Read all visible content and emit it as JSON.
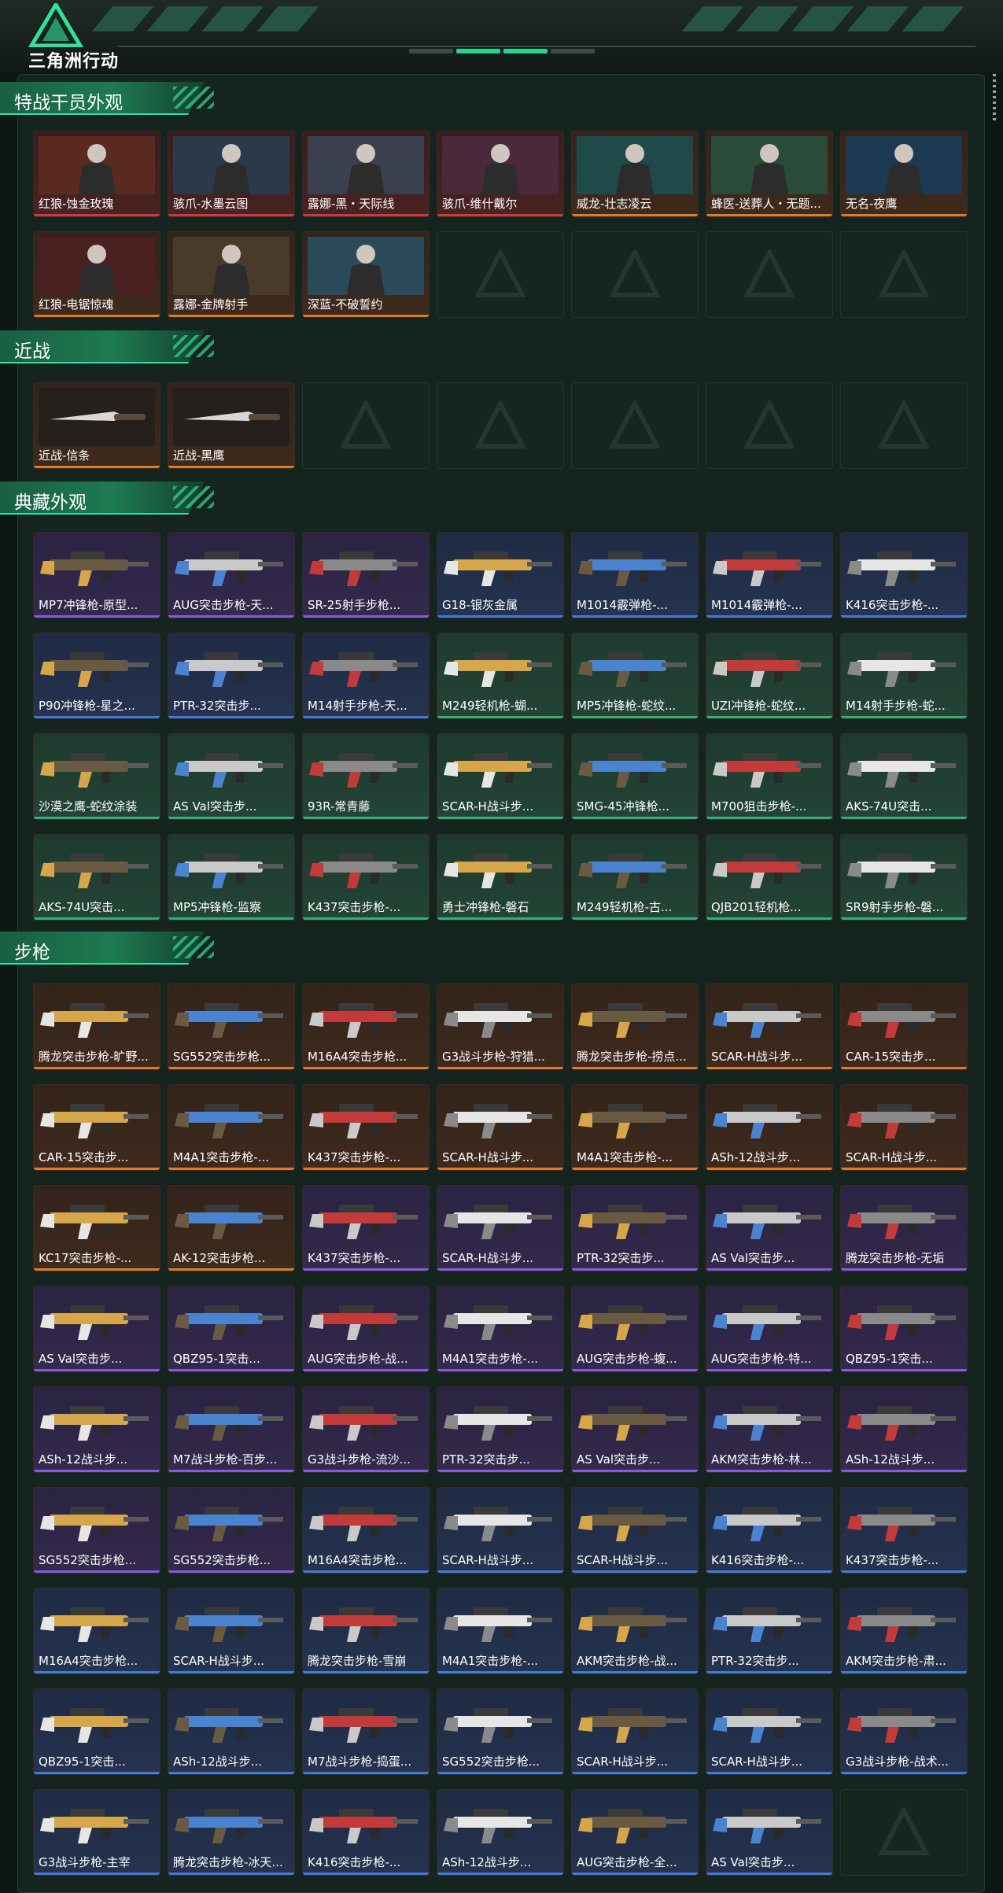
{
  "header": {
    "logo_text": "三角洲行动"
  },
  "sections": [
    {
      "title": "特战干员外观",
      "items": [
        {
          "label": "红狼-蚀金玫瑰",
          "rarity": "red"
        },
        {
          "label": "骇爪-水墨云图",
          "rarity": "red"
        },
        {
          "label": "露娜-黑・天际线",
          "rarity": "red"
        },
        {
          "label": "骇爪-维什戴尔",
          "rarity": "red"
        },
        {
          "label": "威龙-壮志凌云",
          "rarity": "orange"
        },
        {
          "label": "蜂医-送葬人・无题...",
          "rarity": "orange"
        },
        {
          "label": "无名-夜鹰",
          "rarity": "orange"
        },
        {
          "label": "红狼-电锯惊魂",
          "rarity": "orange"
        },
        {
          "label": "露娜-金牌射手",
          "rarity": "orange"
        },
        {
          "label": "深蓝-不破誓约",
          "rarity": "orange"
        }
      ]
    },
    {
      "title": "近战",
      "items": [
        {
          "label": "近战-信条",
          "rarity": "orange"
        },
        {
          "label": "近战-黑鹰",
          "rarity": "orange"
        }
      ]
    },
    {
      "title": "典藏外观",
      "items": [
        {
          "label": "MP7冲锋枪-原型...",
          "rarity": "purple"
        },
        {
          "label": "AUG突击步枪-天...",
          "rarity": "purple"
        },
        {
          "label": "SR-25射手步枪...",
          "rarity": "purple"
        },
        {
          "label": "G18-银灰金属",
          "rarity": "blue"
        },
        {
          "label": "M1014霰弹枪-...",
          "rarity": "blue"
        },
        {
          "label": "M1014霰弹枪-...",
          "rarity": "blue"
        },
        {
          "label": "K416突击步枪-...",
          "rarity": "blue"
        },
        {
          "label": "P90冲锋枪-星之...",
          "rarity": "blue"
        },
        {
          "label": "PTR-32突击步...",
          "rarity": "blue"
        },
        {
          "label": "M14射手步枪-天...",
          "rarity": "blue"
        },
        {
          "label": "M249轻机枪-蝴...",
          "rarity": "green"
        },
        {
          "label": "MP5冲锋枪-蛇纹...",
          "rarity": "green"
        },
        {
          "label": "UZI冲锋枪-蛇纹...",
          "rarity": "green"
        },
        {
          "label": "M14射手步枪-蛇...",
          "rarity": "green"
        },
        {
          "label": "沙漠之鹰-蛇纹涂装",
          "rarity": "green"
        },
        {
          "label": "AS Val突击步...",
          "rarity": "green"
        },
        {
          "label": "93R-常青藤",
          "rarity": "green"
        },
        {
          "label": "SCAR-H战斗步...",
          "rarity": "green"
        },
        {
          "label": "SMG-45冲锋枪...",
          "rarity": "green"
        },
        {
          "label": "M700狙击步枪-...",
          "rarity": "green"
        },
        {
          "label": "AKS-74U突击...",
          "rarity": "green"
        },
        {
          "label": "AKS-74U突击...",
          "rarity": "green"
        },
        {
          "label": "MP5冲锋枪-监察",
          "rarity": "green"
        },
        {
          "label": "K437突击步枪-...",
          "rarity": "green"
        },
        {
          "label": "勇士冲锋枪-磐石",
          "rarity": "green"
        },
        {
          "label": "M249轻机枪-古...",
          "rarity": "green"
        },
        {
          "label": "QJB201轻机枪...",
          "rarity": "green"
        },
        {
          "label": "SR9射手步枪-磐...",
          "rarity": "green"
        }
      ]
    },
    {
      "title": "步枪",
      "items": [
        {
          "label": "腾龙突击步枪-旷野...",
          "rarity": "orange"
        },
        {
          "label": "SG552突击步枪...",
          "rarity": "orange"
        },
        {
          "label": "M16A4突击步枪...",
          "rarity": "orange"
        },
        {
          "label": "G3战斗步枪-狩猎...",
          "rarity": "orange"
        },
        {
          "label": "腾龙突击步枪-捞点...",
          "rarity": "orange"
        },
        {
          "label": "SCAR-H战斗步...",
          "rarity": "orange"
        },
        {
          "label": "CAR-15突击步...",
          "rarity": "orange"
        },
        {
          "label": "CAR-15突击步...",
          "rarity": "orange"
        },
        {
          "label": "M4A1突击步枪-...",
          "rarity": "orange"
        },
        {
          "label": "K437突击步枪-...",
          "rarity": "orange"
        },
        {
          "label": "SCAR-H战斗步...",
          "rarity": "orange"
        },
        {
          "label": "M4A1突击步枪-...",
          "rarity": "orange"
        },
        {
          "label": "ASh-12战斗步...",
          "rarity": "orange"
        },
        {
          "label": "SCAR-H战斗步...",
          "rarity": "orange"
        },
        {
          "label": "KC17突击步枪-...",
          "rarity": "orange"
        },
        {
          "label": "AK-12突击步枪...",
          "rarity": "orange"
        },
        {
          "label": "K437突击步枪-...",
          "rarity": "purple"
        },
        {
          "label": "SCAR-H战斗步...",
          "rarity": "purple"
        },
        {
          "label": "PTR-32突击步...",
          "rarity": "purple"
        },
        {
          "label": "AS Val突击步...",
          "rarity": "purple"
        },
        {
          "label": "腾龙突击步枪-无垢",
          "rarity": "purple"
        },
        {
          "label": "AS Val突击步...",
          "rarity": "purple"
        },
        {
          "label": "QBZ95-1突击...",
          "rarity": "purple"
        },
        {
          "label": "AUG突击步枪-战...",
          "rarity": "purple"
        },
        {
          "label": "M4A1突击步枪-...",
          "rarity": "purple"
        },
        {
          "label": "AUG突击步枪-蝮...",
          "rarity": "purple"
        },
        {
          "label": "AUG突击步枪-特...",
          "rarity": "purple"
        },
        {
          "label": "QBZ95-1突击...",
          "rarity": "purple"
        },
        {
          "label": "ASh-12战斗步...",
          "rarity": "purple"
        },
        {
          "label": "M7战斗步枪-百步...",
          "rarity": "purple"
        },
        {
          "label": "G3战斗步枪-流沙...",
          "rarity": "purple"
        },
        {
          "label": "PTR-32突击步...",
          "rarity": "purple"
        },
        {
          "label": "AS Val突击步...",
          "rarity": "purple"
        },
        {
          "label": "AKM突击步枪-林...",
          "rarity": "purple"
        },
        {
          "label": "ASh-12战斗步...",
          "rarity": "purple"
        },
        {
          "label": "SG552突击步枪...",
          "rarity": "purple"
        },
        {
          "label": "SG552突击步枪...",
          "rarity": "purple"
        },
        {
          "label": "M16A4突击步枪...",
          "rarity": "blue"
        },
        {
          "label": "SCAR-H战斗步...",
          "rarity": "blue"
        },
        {
          "label": "SCAR-H战斗步...",
          "rarity": "blue"
        },
        {
          "label": "K416突击步枪-...",
          "rarity": "blue"
        },
        {
          "label": "K437突击步枪-...",
          "rarity": "blue"
        },
        {
          "label": "M16A4突击步枪...",
          "rarity": "blue"
        },
        {
          "label": "SCAR-H战斗步...",
          "rarity": "blue"
        },
        {
          "label": "腾龙突击步枪-雪崩",
          "rarity": "blue"
        },
        {
          "label": "M4A1突击步枪-...",
          "rarity": "blue"
        },
        {
          "label": "AKM突击步枪-战...",
          "rarity": "blue"
        },
        {
          "label": "PTR-32突击步...",
          "rarity": "blue"
        },
        {
          "label": "AKM突击步枪-肃...",
          "rarity": "blue"
        },
        {
          "label": "QBZ95-1突击...",
          "rarity": "blue"
        },
        {
          "label": "ASh-12战斗步...",
          "rarity": "blue"
        },
        {
          "label": "M7战斗步枪-捣蛋...",
          "rarity": "blue"
        },
        {
          "label": "SG552突击步枪...",
          "rarity": "blue"
        },
        {
          "label": "SCAR-H战斗步...",
          "rarity": "blue"
        },
        {
          "label": "SCAR-H战斗步...",
          "rarity": "blue"
        },
        {
          "label": "G3战斗步枪-战术...",
          "rarity": "blue"
        },
        {
          "label": "G3战斗步枪-主宰",
          "rarity": "blue"
        },
        {
          "label": "腾龙突击步枪-冰天...",
          "rarity": "blue"
        },
        {
          "label": "K416突击步枪-...",
          "rarity": "blue"
        },
        {
          "label": "ASh-12战斗步...",
          "rarity": "blue"
        },
        {
          "label": "AUG突击步枪-全...",
          "rarity": "blue"
        },
        {
          "label": "AS Val突击步...",
          "rarity": "blue"
        }
      ]
    }
  ],
  "colors": {
    "accent": "#28d391",
    "red": "#cc3b3b",
    "orange": "#e07a27",
    "purple": "#8a58e6",
    "blue": "#3d7be0",
    "green": "#2fb27a"
  }
}
